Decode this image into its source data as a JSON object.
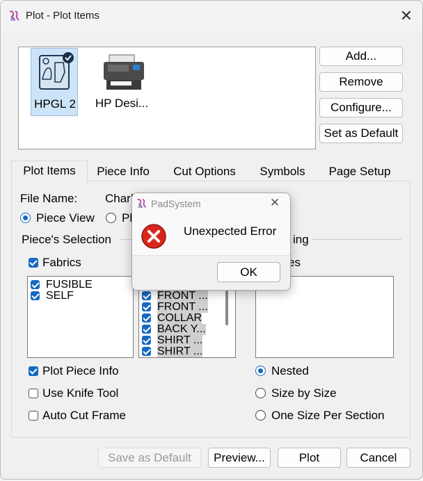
{
  "window": {
    "title": "Plot - Plot Items",
    "close_glyph": "✕"
  },
  "printers": [
    {
      "label": "HPGL 2",
      "selected": true,
      "default": true,
      "icon": "plotter-icon"
    },
    {
      "label": "HP Desi...",
      "selected": false,
      "default": false,
      "icon": "printer-icon"
    }
  ],
  "side_buttons": {
    "add": "Add...",
    "remove": "Remove",
    "configure": "Configure...",
    "set_default": "Set as Default"
  },
  "tabs": [
    "Plot Items",
    "Piece Info",
    "Cut Options",
    "Symbols",
    "Page Setup"
  ],
  "plot_items": {
    "file_name_label": "File Name:",
    "file_name_value": "Charl",
    "view_piece": "Piece View",
    "view_other_partial": "Pl",
    "pieces_selection": "Piece's Selection",
    "group_right_partial": "ing",
    "fabrics_label": "Fabrics",
    "sizes_label_partial": "es",
    "fabrics": [
      "FUSIBLE",
      "SELF"
    ],
    "pieces": [
      "FRONT ...",
      "FRONT ...",
      "COLLAR",
      "BACK Y...",
      "SHIRT ...",
      "SHIRT ..."
    ],
    "plot_piece_info": "Plot Piece Info",
    "use_knife_tool": "Use Knife Tool",
    "auto_cut_frame": "Auto Cut Frame",
    "nested": "Nested",
    "size_by_size": "Size by Size",
    "one_size_per_section": "One Size Per Section"
  },
  "footer": {
    "save_default": "Save as Default",
    "preview": "Preview...",
    "plot": "Plot",
    "cancel": "Cancel"
  },
  "dialog": {
    "title": "PadSystem",
    "message": "Unexpected Error",
    "ok": "OK",
    "close_glyph": "✕",
    "icon": "error-icon"
  },
  "colors": {
    "accent": "#1768c2",
    "error": "#c42b1c"
  }
}
